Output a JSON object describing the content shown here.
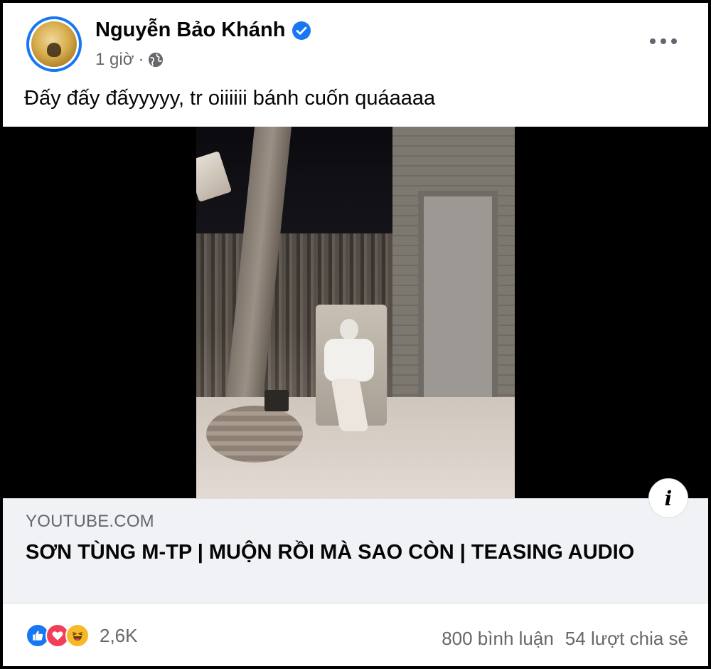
{
  "post": {
    "author": "Nguyễn Bảo Khánh",
    "verified": true,
    "time": "1 giờ",
    "separator": "·",
    "audience_icon": "globe-icon",
    "text": "Đấy đấy đấyyyyy, tr oiiiiii bánh cuốn quáaaaa"
  },
  "link_preview": {
    "domain": "YOUTUBE.COM",
    "title": "SƠN TÙNG M-TP | MUỘN RỒI MÀ SAO CÒN | TEASING AUDIO",
    "info_label": "i"
  },
  "engagement": {
    "reactions": [
      "like-icon",
      "love-icon",
      "haha-icon"
    ],
    "reaction_count": "2,6K",
    "comments": "800 bình luận",
    "shares": "54 lượt chia sẻ"
  },
  "colors": {
    "brand": "#1877f2",
    "love": "#f33e58",
    "haha": "#f7b928",
    "secondary_text": "#65676b"
  }
}
